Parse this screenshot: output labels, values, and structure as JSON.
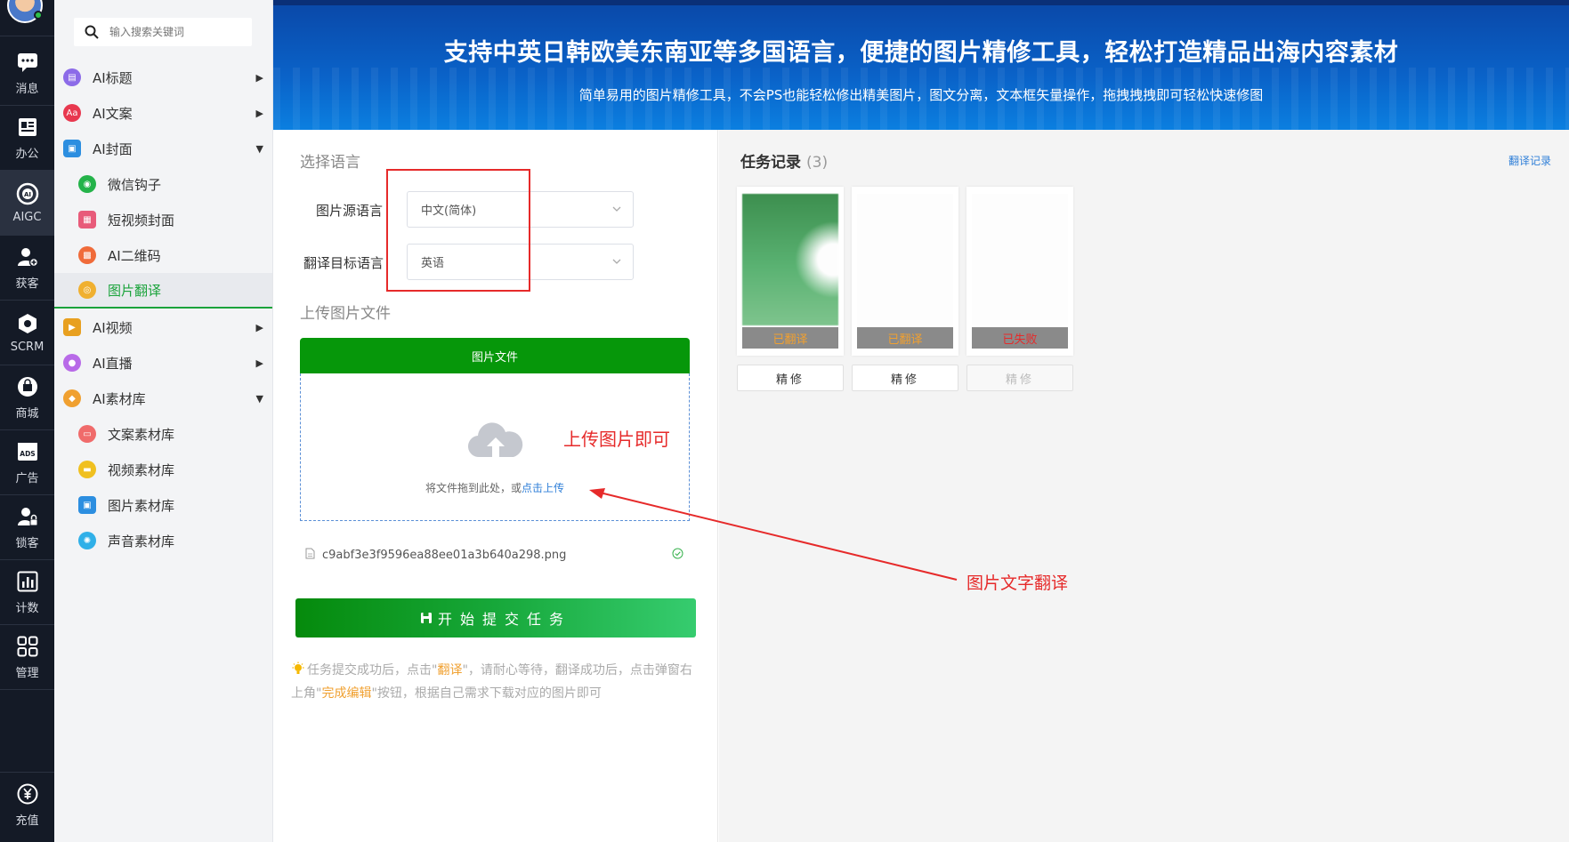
{
  "rail": {
    "items": [
      {
        "label": "消息",
        "icon": "chat-icon"
      },
      {
        "label": "办公",
        "icon": "office-icon"
      },
      {
        "label": "AIGC",
        "icon": "ai-icon"
      },
      {
        "label": "获客",
        "icon": "user-add-icon"
      },
      {
        "label": "SCRM",
        "icon": "scrm-icon"
      },
      {
        "label": "商城",
        "icon": "shop-icon"
      },
      {
        "label": "广告",
        "icon": "ads-icon"
      },
      {
        "label": "锁客",
        "icon": "user-lock-icon"
      },
      {
        "label": "计数",
        "icon": "chart-icon"
      },
      {
        "label": "管理",
        "icon": "grid-icon"
      }
    ],
    "bottom": {
      "label": "充值",
      "icon": "yuan-icon"
    }
  },
  "sidebar": {
    "search_placeholder": "输入搜索关键词",
    "menu": [
      {
        "label": "AI标题",
        "color": "#8c6be8",
        "arrow": "▶"
      },
      {
        "label": "AI文案",
        "color": "#e8384f",
        "arrow": "▶"
      },
      {
        "label": "AI封面",
        "color": "#2c8ee0",
        "arrow": "▼"
      },
      {
        "label": "微信钩子",
        "color": "#24b34a"
      },
      {
        "label": "短视频封面",
        "color": "#e85b7a"
      },
      {
        "label": "AI二维码",
        "color": "#f06b3a"
      },
      {
        "label": "图片翻译",
        "color": "#f0b030"
      },
      {
        "label": "AI视频",
        "color": "#e8a020",
        "arrow": "▶"
      },
      {
        "label": "AI直播",
        "color": "#b86ae8",
        "arrow": "▶"
      },
      {
        "label": "AI素材库",
        "color": "#f0a030",
        "arrow": "▼"
      },
      {
        "label": "文案素材库",
        "color": "#f06b6b"
      },
      {
        "label": "视频素材库",
        "color": "#f0c020"
      },
      {
        "label": "图片素材库",
        "color": "#2c8ee0"
      },
      {
        "label": "声音素材库",
        "color": "#30b0e8"
      }
    ]
  },
  "banner": {
    "title": "支持中英日韩欧美东南亚等多国语言，便捷的图片精修工具，轻松打造精品出海内容素材",
    "subtitle": "简单易用的图片精修工具，不会PS也能轻松修出精美图片，图文分离，文本框矢量操作，拖拽拽拽即可轻松快速修图"
  },
  "form": {
    "lang_section": "选择语言",
    "source_label": "图片源语言",
    "source_value": "中文(简体)",
    "target_label": "翻译目标语言",
    "target_value": "英语",
    "upload_section": "上传图片文件",
    "upload_header": "图片文件",
    "upload_hint": "将文件拖到此处，或",
    "upload_link": "点击上传",
    "annotation_upload": "上传图片即可",
    "file_name": "c9abf3e3f9596ea88ee01a3b640a298.png",
    "submit_label": "开始提交任务",
    "tip_1": "任务提交成功后，点击\"",
    "tip_hl_1": "翻译",
    "tip_2": "\"，请耐心等待，翻译成功后，点击弹窗右上角\"",
    "tip_hl_2": "完成编辑",
    "tip_3": "\"按钮，根据自己需求下载对应的图片即可"
  },
  "tasks": {
    "title": "任务记录",
    "count": "(3)",
    "log_link": "翻译记录",
    "annotation": "图片文字翻译",
    "cards": [
      {
        "status": "已翻译",
        "state": "done",
        "button": "精修"
      },
      {
        "status": "已翻译",
        "state": "done",
        "button": "精修"
      },
      {
        "status": "已失败",
        "state": "fail",
        "button": "精修"
      }
    ]
  },
  "colors": {
    "accent_green": "#06970a",
    "annotation_red": "#e62a2a",
    "highlight_orange": "#f0a030",
    "link_blue": "#2f7fd8"
  }
}
